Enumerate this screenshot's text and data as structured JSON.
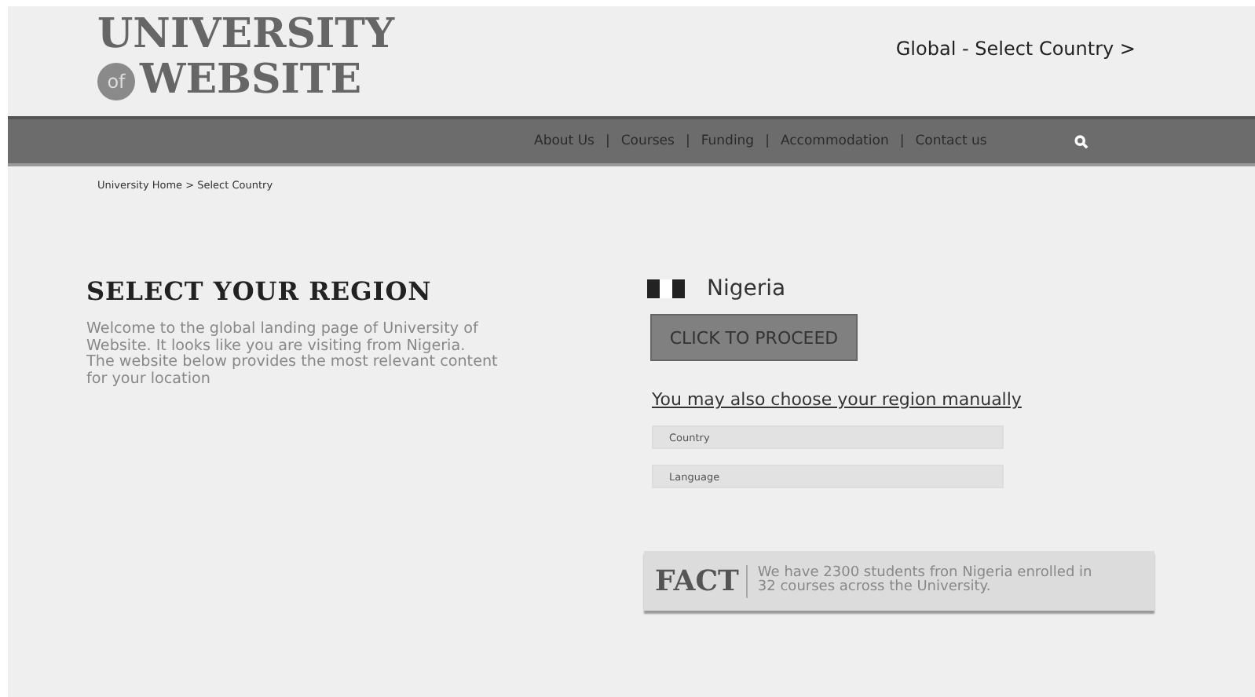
{
  "header": {
    "logo": {
      "line_1": "UNIVERSITY",
      "badge": "of",
      "line_2": "WEBSITE"
    },
    "country_link": "Global - Select Country >"
  },
  "nav": {
    "items": [
      {
        "label": "About Us"
      },
      {
        "label": "Courses"
      },
      {
        "label": "Funding"
      },
      {
        "label": "Accommodation"
      },
      {
        "label": "Contact us"
      }
    ],
    "separator": "|"
  },
  "breadcrumb": "University Home > Select Country",
  "intro": {
    "heading": "SELECT YOUR REGION",
    "text": "Welcome to the global landing page of University of Website. It looks like you are visiting from Nigeria. The website below provides the most relevant content for your location"
  },
  "region": {
    "country": "Nigeria",
    "button": "CLICK TO PROCEED",
    "manual_link": "You may also choose your region manually",
    "fields": [
      {
        "placeholder": "Country"
      },
      {
        "placeholder": "Language"
      }
    ]
  },
  "fact": {
    "label": "FACT",
    "text": "We have 2300 students fron Nigeria enrolled in 32 courses across the University."
  }
}
